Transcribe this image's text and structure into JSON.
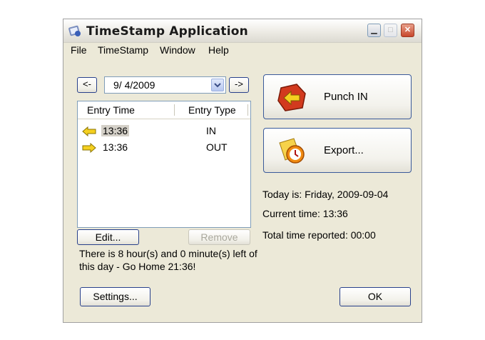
{
  "window": {
    "title": "TimeStamp Application"
  },
  "menu": [
    "File",
    "TimeStamp",
    "Window",
    "Help"
  ],
  "date_nav": {
    "prev_label": "<-",
    "next_label": "->",
    "date_value": "9/ 4/2009"
  },
  "list": {
    "headers": [
      "Entry Time",
      "Entry Type"
    ],
    "rows": [
      {
        "time": "13:36",
        "type": "IN"
      },
      {
        "time": "13:36",
        "type": "OUT"
      }
    ]
  },
  "buttons": {
    "edit": "Edit...",
    "remove": "Remove",
    "punch_in": "Punch IN",
    "export": "Export...",
    "settings": "Settings...",
    "ok": "OK"
  },
  "message": "There is 8 hour(s) and 0 minute(s) left of this day - Go Home 21:36!",
  "info": {
    "today": "Today is: Friday, 2009-09-04",
    "current_time": "Current time: 13:36",
    "total": "Total time reported: 00:00"
  },
  "icons": {
    "app": "timestamp-app-icon",
    "in_arrow": "arrow-left-icon",
    "out_arrow": "arrow-right-icon",
    "punch": "punch-in-icon",
    "export": "export-clock-icon"
  },
  "colors": {
    "arrow_yellow": "#f5d020",
    "punch_red": "#d23a1e",
    "export_orange": "#f08a10"
  }
}
